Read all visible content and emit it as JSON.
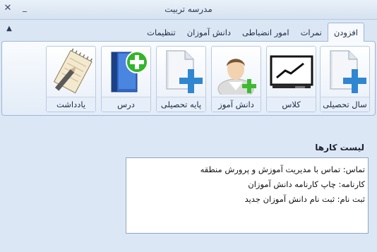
{
  "window": {
    "title": "مدرسه تربیت",
    "close_icon": "close-icon",
    "minimize_icon": "minimize-icon"
  },
  "ribbon": {
    "tabs": [
      {
        "label": "افزودن",
        "active": true
      },
      {
        "label": "نمرات",
        "active": false
      },
      {
        "label": "امور انضباطی",
        "active": false
      },
      {
        "label": "دانش آموزان",
        "active": false
      },
      {
        "label": "تنظیمات",
        "active": false
      }
    ],
    "buttons": [
      {
        "label": "سال تحصیلی",
        "icon": "document-add-icon"
      },
      {
        "label": "کلاس",
        "icon": "whiteboard-chart-icon"
      },
      {
        "label": "دانش آموز",
        "icon": "student-add-icon"
      },
      {
        "label": "پایه تحصیلی",
        "icon": "document-add-icon"
      },
      {
        "label": "درس",
        "icon": "book-add-icon"
      },
      {
        "label": "یادداشت",
        "icon": "notepad-pencil-icon"
      }
    ],
    "collapse_icon": "chevron-up-icon"
  },
  "tasks": {
    "title": "لیست کارها",
    "items": [
      "تماس: تماس با مدیریت آموزش و پرورش منطقه",
      "کارنامه: چاپ کارنامه دانش آموزان",
      "ثبت نام: ثبت نام دانش آموزان جدید"
    ]
  },
  "colors": {
    "background": "#dbe6f4",
    "accent_plus": "#3a8fd6",
    "green_plus": "#3dbb2f"
  }
}
